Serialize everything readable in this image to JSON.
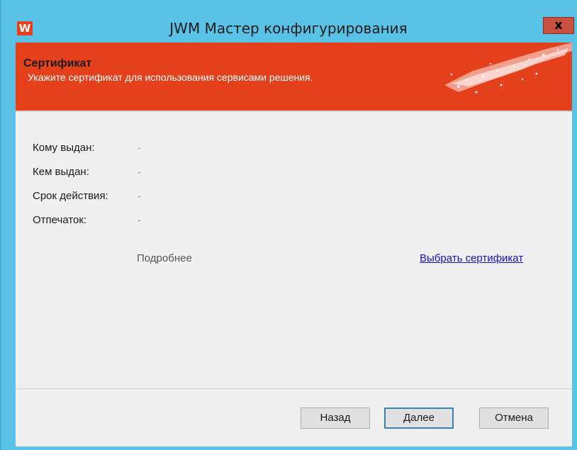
{
  "window": {
    "app_icon_letter": "W",
    "title": "JWM Мастер конфигурирования",
    "close_label": "x"
  },
  "banner": {
    "title": "Сертификат",
    "subtitle": "Укажите сертификат для использования сервисами решения."
  },
  "fields": [
    {
      "label": "Кому выдан:",
      "value": "-"
    },
    {
      "label": "Кем выдан:",
      "value": "-"
    },
    {
      "label": "Срок действия:",
      "value": "-"
    },
    {
      "label": "Отпечаток:",
      "value": "-"
    }
  ],
  "links": {
    "details": "Подробнее",
    "choose_certificate": "Выбрать сертификат"
  },
  "buttons": {
    "back": "Назад",
    "next": "Далее",
    "cancel": "Отмена"
  },
  "colors": {
    "accent": "#e5401c",
    "frame": "#5bc2e7",
    "link": "#1a0dcc"
  }
}
